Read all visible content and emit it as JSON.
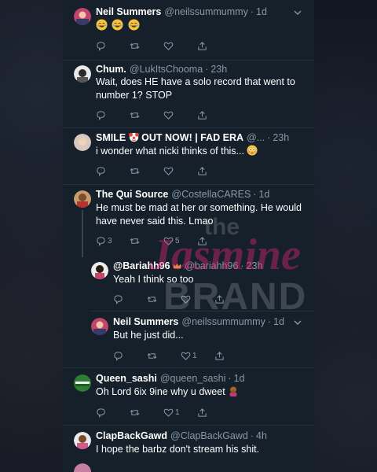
{
  "colors": {
    "background": "#15202b",
    "text_primary": "#ffffff",
    "text_secondary": "#8899a6",
    "divider": "#253341",
    "watermark_pink": "#e0257d"
  },
  "watermark": {
    "line1": "the",
    "line2": "Jasmine",
    "line3": "BRAND"
  },
  "tweets": [
    {
      "name": "Neil Summers",
      "handle": "@neilssummummy",
      "time": "1d",
      "text": "",
      "emoji": [
        "face-with-tears-of-joy",
        "face-with-tears-of-joy",
        "face-with-tears-of-joy"
      ],
      "counts": {
        "reply": "",
        "retweet": "",
        "like": ""
      }
    },
    {
      "name": "Chum.",
      "handle": "@LukItsChooma",
      "time": "23h",
      "text": "Wait, does HE have a solo record that went to number 1? STOP",
      "counts": {
        "reply": "",
        "retweet": "",
        "like": ""
      }
    },
    {
      "name": "SMILE",
      "name_rest": "OUT NOW! | FAD ERA",
      "handle": "@...",
      "time": "23h",
      "text": "i wonder what nicki thinks of this...",
      "counts": {
        "reply": "",
        "retweet": "",
        "like": ""
      }
    },
    {
      "name": "The Qui Source",
      "handle": "@CostellaCARES",
      "time": "1d",
      "text": "He must be mad at her or something. He would have never said this. Lmao",
      "counts": {
        "reply": "3",
        "retweet": "",
        "like": "5"
      }
    },
    {
      "name": "@Bariahh96",
      "handle": "@bariahh96",
      "time": "23h",
      "text": "Yeah I think so too",
      "counts": {
        "reply": "",
        "retweet": "",
        "like": ""
      }
    },
    {
      "name": "Neil Summers",
      "handle": "@neilssummummy",
      "time": "1d",
      "text": "But he just did...",
      "counts": {
        "reply": "",
        "retweet": "",
        "like": "1"
      }
    },
    {
      "name": "Queen_sashi",
      "handle": "@queen_sashi",
      "time": "1d",
      "text": "Oh Lord 6ix 9ine why u dweet",
      "counts": {
        "reply": "",
        "retweet": "",
        "like": "1"
      }
    },
    {
      "name": "ClapBackGawd",
      "handle": "@ClapBackGawd",
      "time": "4h",
      "text": "I hope the barbz don't stream his shit.",
      "counts": {
        "reply": "",
        "retweet": "",
        "like": ""
      }
    }
  ],
  "separator": "·"
}
